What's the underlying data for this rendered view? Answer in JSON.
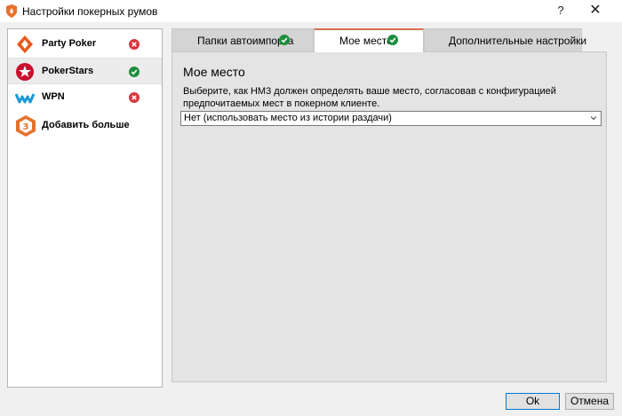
{
  "window": {
    "title": "Настройки покерных румов",
    "help": "?",
    "close": "✕"
  },
  "sidebar": {
    "rooms": [
      {
        "label": "Party Poker",
        "status": "error"
      },
      {
        "label": "PokerStars",
        "status": "ok",
        "selected": true
      },
      {
        "label": "WPN",
        "status": "error"
      },
      {
        "label": "Добавить больше румов"
      }
    ]
  },
  "tabs": [
    {
      "label": "Папки автоимпорта",
      "status": "ok"
    },
    {
      "label": "Мое место",
      "status": "ok",
      "active": true
    },
    {
      "label": "Дополнительные настройки"
    }
  ],
  "panel": {
    "heading": "Мое место",
    "description": "Выберите, как HM3 должен определять ваше место, согласовав с конфигурацией предпочитаемых мест в покерном клиенте.",
    "seat_select_value": "Нет (использовать место из истории раздачи)"
  },
  "buttons": {
    "ok": "Ok",
    "cancel": "Отмена"
  },
  "colors": {
    "ok": "#1e8e3e",
    "error": "#d9363e",
    "accent": "#d9704a",
    "default_button_border": "#0078d7"
  }
}
